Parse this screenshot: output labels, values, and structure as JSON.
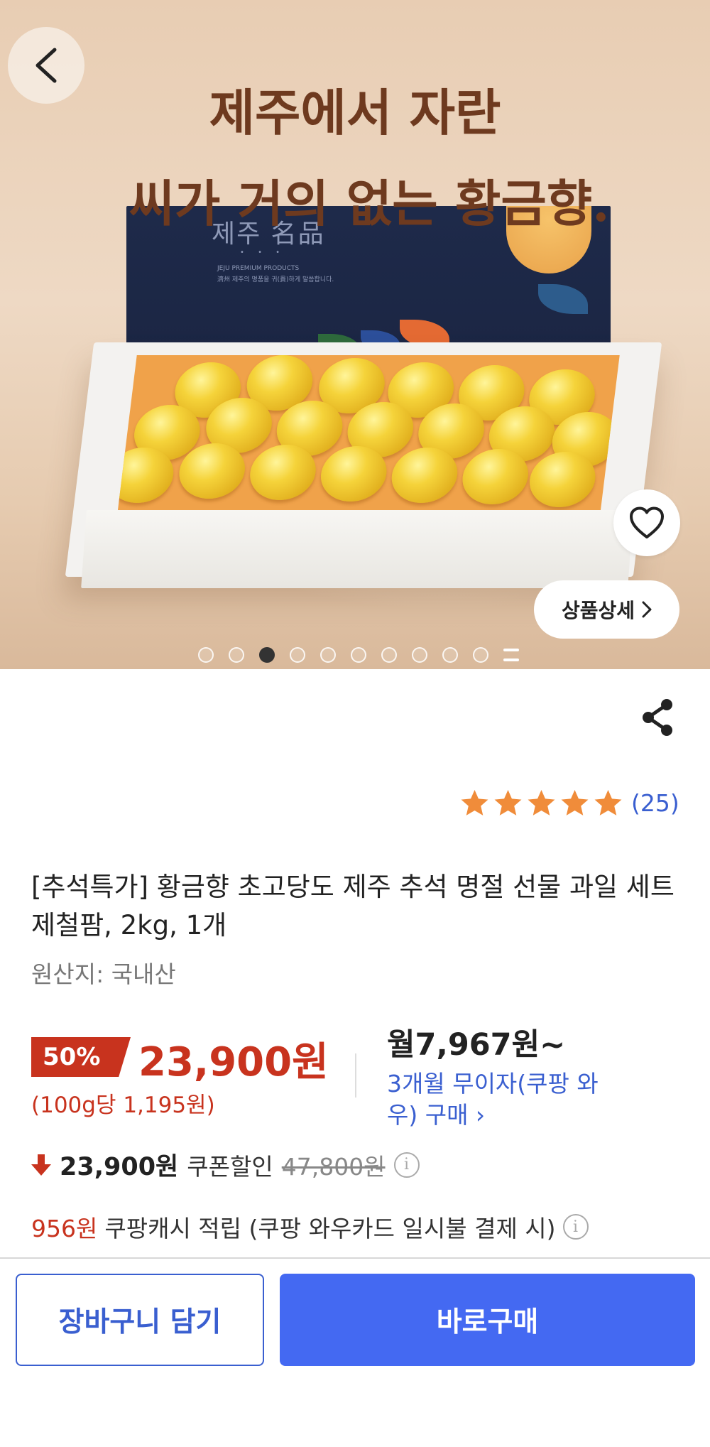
{
  "hero": {
    "headline_line1": "제주에서 자란",
    "headline_line2": "씨가 거의 없는 황금향.",
    "box_brand": "제주 名品",
    "box_tiny_text": "JEJU PREMIUM PRODUCTS\n濟州 제주의 명품을 귀(貴)하게 말씀합니다.",
    "detail_button_label": "상품상세",
    "pager": {
      "total_dots": 10,
      "active_index": 2
    }
  },
  "icons": {
    "back": "chevron-left-icon",
    "favorite": "heart-outline-icon",
    "detail": "chevron-right-icon",
    "share": "share-icon",
    "star": "star-icon",
    "coupon": "arrow-down-icon",
    "info": "info-icon"
  },
  "rating": {
    "stars": 5,
    "review_count": "(25)"
  },
  "product": {
    "title": "[추석특가] 황금향 초고당도 제주 추석 명절 선물 과일 세트 제철팜, 2kg, 1개",
    "origin": "원산지: 국내산"
  },
  "pricing": {
    "discount_rate": "50%",
    "price": "23,900원",
    "unit_price": "(100g당 1,195원)",
    "monthly": "월7,967원~",
    "installment_text": "3개월 무이자(쿠팡 와우) 구매 ›"
  },
  "coupon": {
    "price": "23,900원",
    "label": "쿠폰할인",
    "original_price": "47,800원"
  },
  "cash": {
    "amount": "956원",
    "label": "쿠팡캐시 적립 (쿠팡 와우카드 일시불 결제 시)"
  },
  "actions": {
    "cart_label": "장바구니 담기",
    "buy_label": "바로구매"
  },
  "colors": {
    "accent_red": "#c8331e",
    "accent_blue": "#3a5fd0",
    "buy_button": "#4469f2",
    "star": "#f08c3a"
  }
}
